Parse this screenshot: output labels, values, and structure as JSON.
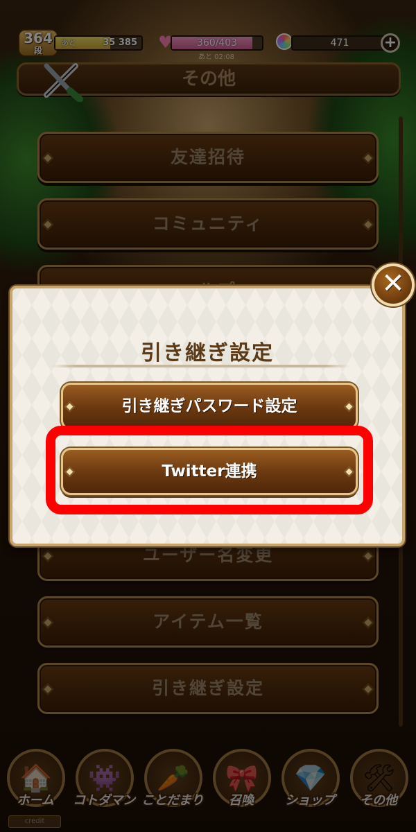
{
  "status_bar": {
    "level": "364",
    "level_unit": "段",
    "exp_prefix": "あと",
    "exp_remaining": "35",
    "exp_total": "385",
    "exp_progress": 0.64,
    "stamina": "360/403",
    "stamina_progress": 0.89,
    "stamina_timer": "あと 02:08",
    "gems": "471"
  },
  "header": {
    "title": "その他",
    "icon": "tools-icon"
  },
  "menu": {
    "items": [
      {
        "label": "友達招待"
      },
      {
        "label": "コミュニティ"
      },
      {
        "label": "ヘルプ"
      },
      {
        "label": ""
      },
      {
        "label": "ユーザー名変更"
      },
      {
        "label": "アイテム一覧"
      },
      {
        "label": "引き継ぎ設定"
      }
    ]
  },
  "dialog": {
    "title": "引き継ぎ設定",
    "buttons": [
      {
        "label": "引き継ぎパスワード設定"
      },
      {
        "label": "Twitter連携"
      }
    ],
    "close_icon": "close-icon"
  },
  "bottom_nav": {
    "items": [
      {
        "label": "ホーム",
        "icon": "house-icon"
      },
      {
        "label": "コトダマン",
        "icon": "characters-icon"
      },
      {
        "label": "ことだまり",
        "icon": "carrots-icon"
      },
      {
        "label": "召喚",
        "icon": "summon-icon"
      },
      {
        "label": "ショップ",
        "icon": "shop-icon"
      },
      {
        "label": "その他",
        "icon": "tools-icon"
      }
    ],
    "credit": "credit"
  },
  "colors": {
    "highlight": "#ff0000",
    "button_brown": "#6d3a10",
    "dialog_bg": "#f3efe6"
  }
}
